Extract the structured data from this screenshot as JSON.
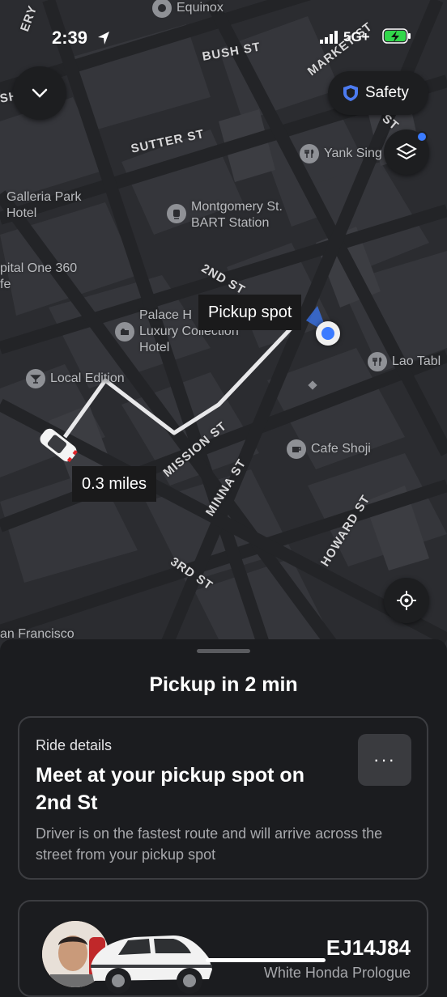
{
  "status_bar": {
    "time": "2:39",
    "network": "5G+"
  },
  "map": {
    "streets": [
      "BUSH ST",
      "SUTTER ST",
      "2ND ST",
      "MARKET ST",
      "MISSION ST",
      "MINNA ST",
      "3RD ST",
      "HOWARD ST",
      "ST",
      "SH",
      "ERY"
    ],
    "pois": {
      "equinox": "Equinox",
      "galleria": "Galleria Park\nHotel",
      "bart": "Montgomery St.\nBART Station",
      "capital": "pital One 360\nfe",
      "palace": "Palace H\nLuxury Collection\nHotel",
      "yank": "Yank Sing",
      "lao": "Lao Tabl",
      "local_edition": "Local Edition",
      "cafe": "Cafe Shoji",
      "san_francisco": "an Francisco"
    },
    "pickup_tag": "Pickup spot",
    "distance_tag": "0.3 miles",
    "safety_label": "Safety"
  },
  "sheet": {
    "title": "Pickup in 2 min",
    "details": {
      "label": "Ride details",
      "heading": "Meet at your pickup spot on 2nd St",
      "body": "Driver is on the fastest route and will arrive across the street from your pickup spot",
      "more_label": "···"
    },
    "driver": {
      "plate": "EJ14J84",
      "car": "White Honda Prologue"
    }
  },
  "colors": {
    "accent_blue": "#3b7bff",
    "map_bg": "#2b2c30",
    "sheet_bg": "#1b1c1f"
  }
}
